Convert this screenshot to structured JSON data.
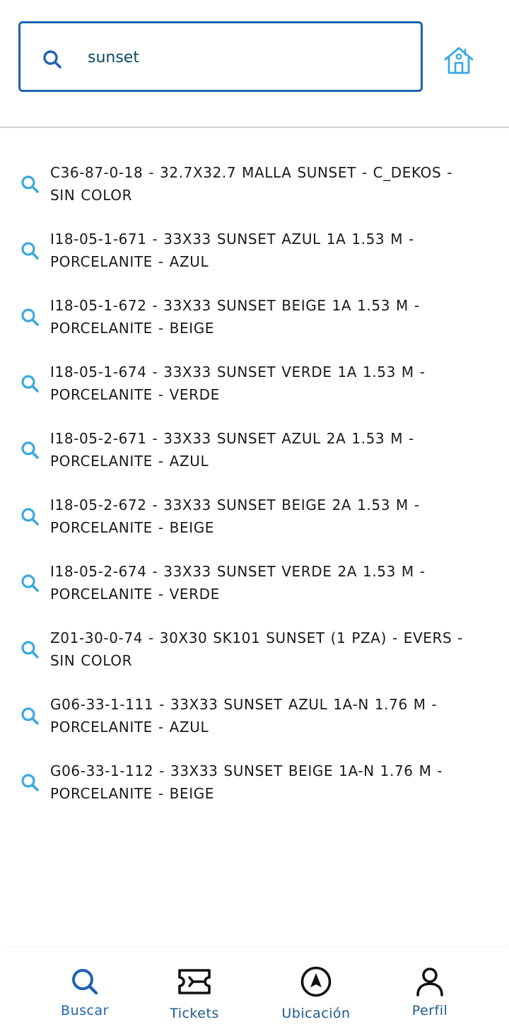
{
  "search": {
    "value": "sunset",
    "placeholder": ""
  },
  "header": {
    "home_icon": "home-icon"
  },
  "colors": {
    "accent": "#1e63b3",
    "result_icon": "#3aa9e0",
    "text": "#1a1a1a",
    "nav_label": "#1e5a8c"
  },
  "results": [
    {
      "line1": "C36-87-0-18 - 32.7X32.7 MALLA SUNSET - C_DEKOS -",
      "line2": "SIN COLOR"
    },
    {
      "line1": "I18-05-1-671 - 33X33 SUNSET AZUL 1A 1.53 M -",
      "line2": "PORCELANITE - AZUL"
    },
    {
      "line1": "I18-05-1-672 - 33X33 SUNSET BEIGE 1A 1.53 M -",
      "line2": "PORCELANITE - BEIGE"
    },
    {
      "line1": "I18-05-1-674 - 33X33 SUNSET VERDE 1A 1.53 M -",
      "line2": "PORCELANITE - VERDE"
    },
    {
      "line1": "I18-05-2-671 - 33X33 SUNSET AZUL 2A 1.53 M -",
      "line2": "PORCELANITE - AZUL"
    },
    {
      "line1": "I18-05-2-672 - 33X33 SUNSET BEIGE 2A 1.53 M -",
      "line2": "PORCELANITE - BEIGE"
    },
    {
      "line1": "I18-05-2-674 - 33X33 SUNSET VERDE 2A 1.53 M -",
      "line2": "PORCELANITE - VERDE"
    },
    {
      "line1": "Z01-30-0-74 - 30X30 SK101 SUNSET (1 PZA) - EVERS -",
      "line2": "SIN COLOR"
    },
    {
      "line1": "G06-33-1-111 - 33X33 SUNSET AZUL 1A-N 1.76 M -",
      "line2": "PORCELANITE - AZUL"
    },
    {
      "line1": "G06-33-1-112 - 33X33 SUNSET BEIGE 1A-N 1.76 M -",
      "line2": "PORCELANITE - BEIGE"
    }
  ],
  "nav": {
    "items": [
      {
        "label": "Buscar",
        "icon": "search-icon",
        "active": true
      },
      {
        "label": "Tickets",
        "icon": "ticket-icon",
        "active": false
      },
      {
        "label": "Ubicación",
        "icon": "compass-icon",
        "active": false
      },
      {
        "label": "Perfil",
        "icon": "person-icon",
        "active": false
      }
    ]
  }
}
